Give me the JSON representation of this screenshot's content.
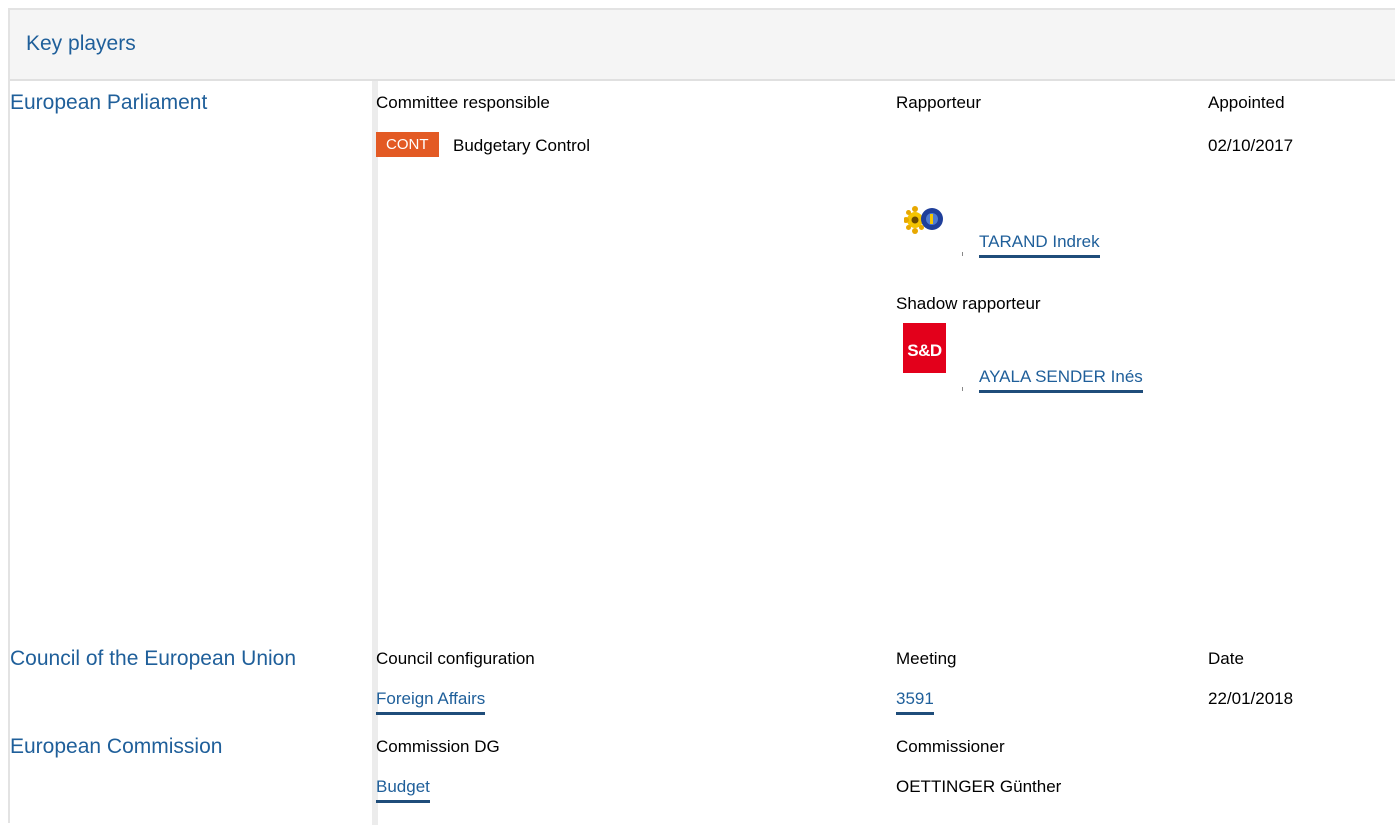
{
  "header": {
    "title": "Key players"
  },
  "ep": {
    "title": "European Parliament",
    "col_committee": "Committee responsible",
    "col_rapporteur": "Rapporteur",
    "col_appointed": "Appointed",
    "committee_badge": "CONT",
    "committee_name": "Budgetary Control",
    "appointed_date": "02/10/2017",
    "rapporteur": "TARAND Indrek",
    "shadow_label": "Shadow rapporteur",
    "shadow_rapporteur": "AYALA SENDER Inés",
    "sd_logo_text": "S&D",
    "badge_color": "#e35a24",
    "link_color": "#1f5f9a"
  },
  "council": {
    "title": "Council of the European Union",
    "col_configuration": "Council configuration",
    "col_meeting": "Meeting",
    "col_date": "Date",
    "configuration": "Foreign Affairs",
    "meeting": "3591",
    "date": "22/01/2018"
  },
  "commission": {
    "title": "European Commission",
    "col_dg": "Commission DG",
    "col_commissioner": "Commissioner",
    "dg": "Budget",
    "commissioner": "OETTINGER Günther"
  }
}
